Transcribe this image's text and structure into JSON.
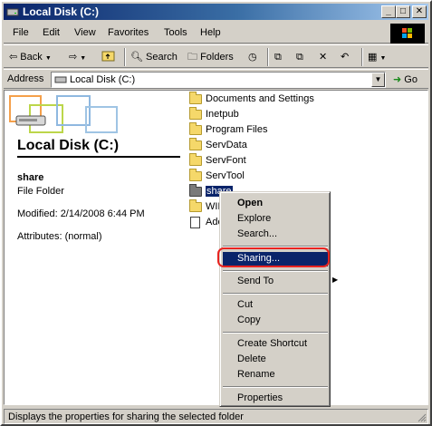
{
  "window": {
    "title": "Local Disk (C:)"
  },
  "menu": [
    "File",
    "Edit",
    "View",
    "Favorites",
    "Tools",
    "Help"
  ],
  "toolbar": {
    "back": "Back",
    "search": "Search",
    "folders": "Folders"
  },
  "address": {
    "label": "Address",
    "value": "Local Disk (C:)",
    "go": "Go"
  },
  "details": {
    "title": "Local Disk (C:)",
    "name": "share",
    "type": "File Folder",
    "modified": "Modified: 2/14/2008 6:44 PM",
    "attributes": "Attributes: (normal)"
  },
  "files": [
    {
      "name": "Documents and Settings",
      "icon": "folder"
    },
    {
      "name": "Inetpub",
      "icon": "folder"
    },
    {
      "name": "Program Files",
      "icon": "folder"
    },
    {
      "name": "ServData",
      "icon": "folder"
    },
    {
      "name": "ServFont",
      "icon": "folder"
    },
    {
      "name": "ServTool",
      "icon": "folder"
    },
    {
      "name": "share",
      "icon": "shared-folder",
      "selected": true
    },
    {
      "name": "WIN",
      "icon": "folder"
    },
    {
      "name": "Ado",
      "icon": "document"
    }
  ],
  "context_menu": {
    "open": "Open",
    "explore": "Explore",
    "search": "Search...",
    "sharing": "Sharing...",
    "send_to": "Send To",
    "cut": "Cut",
    "copy": "Copy",
    "create_shortcut": "Create Shortcut",
    "delete": "Delete",
    "rename": "Rename",
    "properties": "Properties"
  },
  "status": {
    "text": "Displays the properties for sharing the selected folder"
  },
  "colors": {
    "highlight": "#0a246a",
    "annotation": "#e8231f"
  }
}
